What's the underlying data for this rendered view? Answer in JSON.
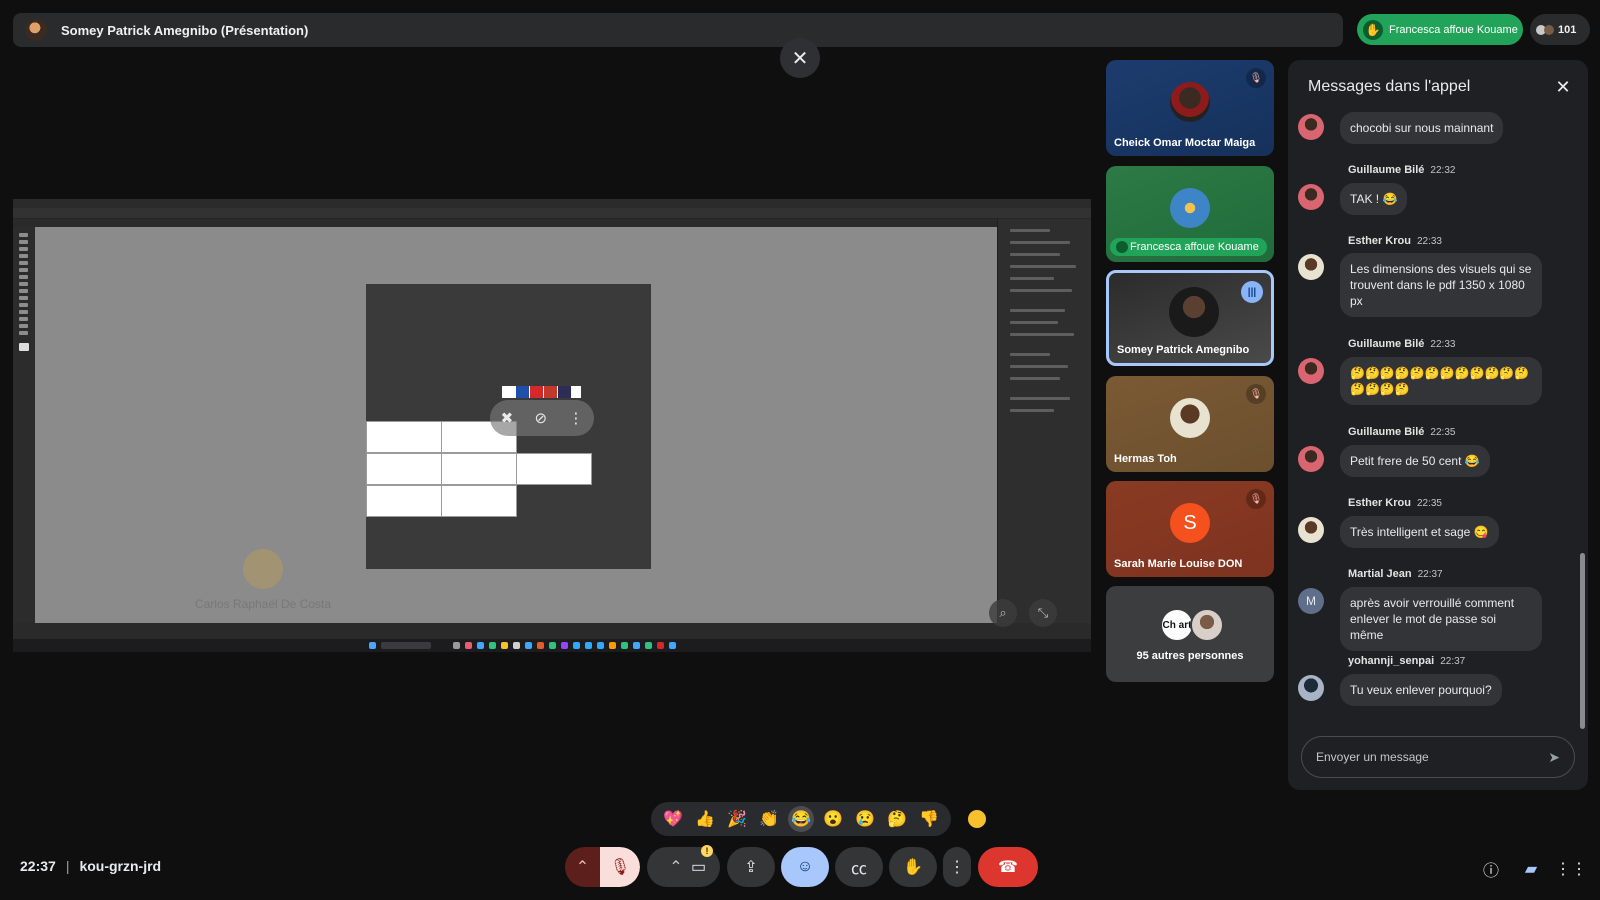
{
  "top_bar": {
    "presenter_title": "Somey Patrick Amegnibo (Présentation)",
    "raised_hand_name": "Francesca affoue Kouame",
    "participant_count": "101"
  },
  "shared_screen": {
    "ghost_participant": "Carlos Raphaël De Costa"
  },
  "tiles": [
    {
      "name": "Cheick Omar Moctar Maiga",
      "muted": true
    },
    {
      "name": "Francesca affoue Kouame",
      "hand_raised": true
    },
    {
      "name": "Somey Patrick Amegnibo",
      "speaking": true
    },
    {
      "name": "Hermas Toh",
      "muted": true
    },
    {
      "name": "Sarah Marie Louise DON",
      "initial": "S",
      "muted": true
    },
    {
      "name": "95 autres personnes",
      "avatar_text": "Ch art"
    }
  ],
  "chat": {
    "title": "Messages dans l'appel",
    "input_placeholder": "Envoyer un message",
    "messages": [
      {
        "author": "",
        "time": "",
        "text": "chocobi sur nous mainnant"
      },
      {
        "author": "Guillaume Bilé",
        "time": "22:32",
        "text": "TAK ! 😂"
      },
      {
        "author": "Esther Krou",
        "time": "22:33",
        "text": "Les dimensions des visuels qui se trouvent dans le pdf 1350 x 1080 px"
      },
      {
        "author": "Guillaume Bilé",
        "time": "22:33",
        "text": "🤔🤔🤔🤔🤔🤔🤔🤔🤔🤔🤔🤔🤔🤔🤔🤔"
      },
      {
        "author": "Guillaume Bilé",
        "time": "22:35",
        "text": "Petit frere de 50 cent 😂"
      },
      {
        "author": "Esther Krou",
        "time": "22:35",
        "text": "Très intelligent et sage 😋"
      },
      {
        "author": "Martial Jean",
        "time": "22:37",
        "text": "après avoir verrouillé comment enlever le mot de passe soi même",
        "initial": "M"
      },
      {
        "author": "yohannji_senpai",
        "time": "22:37",
        "text": "Tu veux enlever pourquoi?"
      }
    ]
  },
  "reactions": [
    "💖",
    "👍",
    "🎉",
    "👏",
    "😂",
    "😮",
    "😢",
    "🤔",
    "👎"
  ],
  "meeting": {
    "time": "22:37",
    "code": "kou-grzn-jrd"
  },
  "colors": {
    "raised_hand": "#22a35a",
    "leave": "#dc362e",
    "reactions_active": "#a8c7fa"
  }
}
